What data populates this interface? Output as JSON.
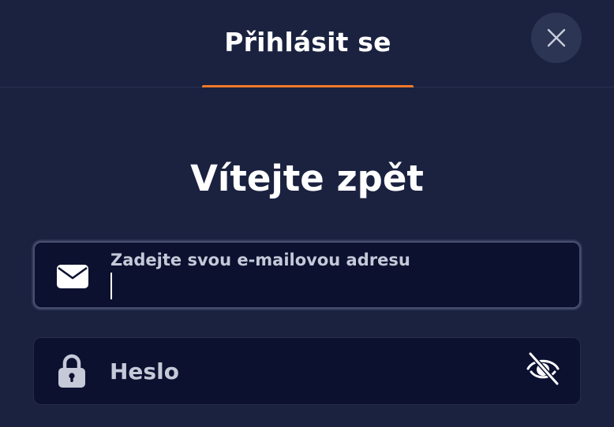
{
  "header": {
    "tab_label": "Přihlásit se",
    "close_icon": "close-icon"
  },
  "main": {
    "welcome_title": "Vítejte zpět",
    "email": {
      "label": "Zadejte svou e-mailovou adresu",
      "value": "",
      "icon": "envelope-icon"
    },
    "password": {
      "placeholder": "Heslo",
      "value": "",
      "icon": "lock-icon",
      "toggle_icon": "eye-slash-icon"
    }
  },
  "colors": {
    "background": "#1b2240",
    "field_background": "#0c1130",
    "accent": "#f07a2a",
    "close_button": "#2d3554",
    "muted_text": "#c5c9d8"
  }
}
